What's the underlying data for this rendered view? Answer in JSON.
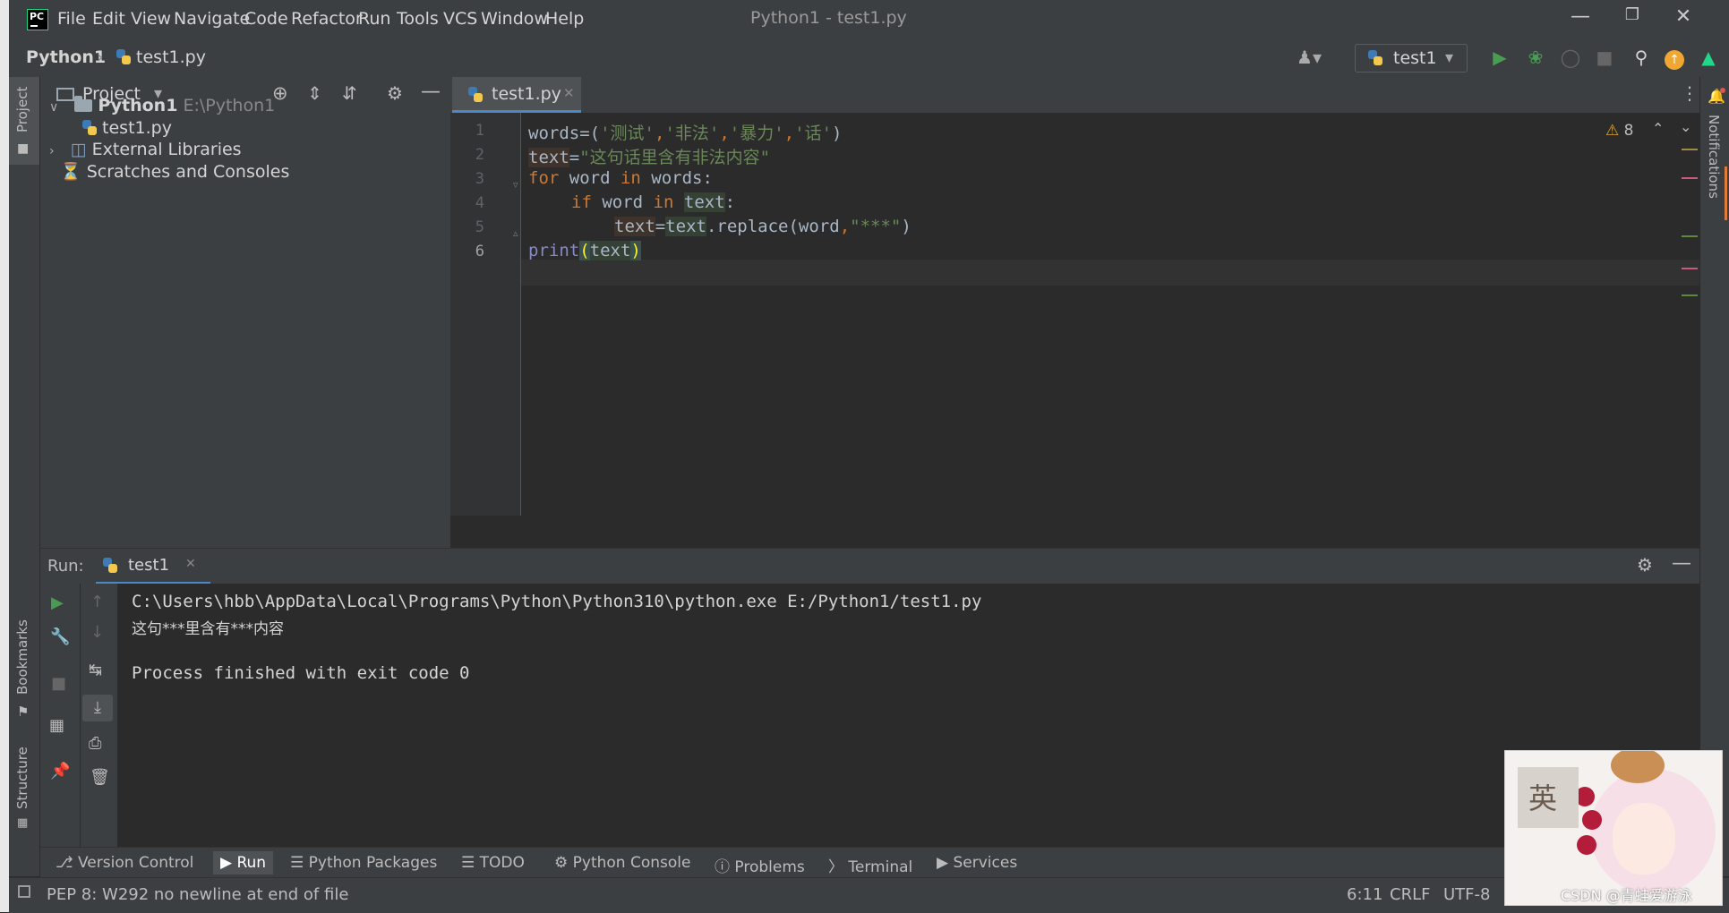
{
  "window": {
    "title": "Python1 - test1.py",
    "menu": [
      "File",
      "Edit",
      "View",
      "Navigate",
      "Code",
      "Refactor",
      "Run",
      "Tools",
      "VCS",
      "Window",
      "Help"
    ]
  },
  "navbar": {
    "project": "Python1",
    "file": "test1.py",
    "run_config": "test1"
  },
  "left_stripe": {
    "project": "Project",
    "bookmarks": "Bookmarks",
    "structure": "Structure"
  },
  "right_stripe": {
    "notifications": "Notifications"
  },
  "project_panel": {
    "title": "Project",
    "root_name": "Python1",
    "root_path": "E:\\Python1",
    "file": "test1.py",
    "external": "External Libraries",
    "scratches": "Scratches and Consoles"
  },
  "editor": {
    "tab": "test1.py",
    "warnings": "8",
    "line_numbers": [
      "1",
      "2",
      "3",
      "4",
      "5",
      "6"
    ],
    "lines": [
      {
        "l1_a": "words",
        "l1_b": "=(",
        "l1_c": "'测试'",
        "l1_d": ",",
        "l1_e": "'非法'",
        "l1_f": ",",
        "l1_g": "'暴力'",
        "l1_h": ",",
        "l1_i": "'话'",
        "l1_j": ")"
      },
      {
        "l2_a": "text",
        "l2_b": "=",
        "l2_c": "\"这句话里含有非法内容\""
      },
      {
        "l3_a": "for",
        "l3_b": " word ",
        "l3_c": "in",
        "l3_d": " words:"
      },
      {
        "l4_a": "if",
        "l4_b": " word ",
        "l4_c": "in",
        "l4_d": " ",
        "l4_e": "text",
        "l4_f": ":"
      },
      {
        "l5_a": "text",
        "l5_b": "=",
        "l5_c": "text",
        "l5_d": ".replace(word",
        "l5_e": ",",
        "l5_f": "\"***\"",
        "l5_g": ")"
      },
      {
        "l6_a": "print",
        "l6_b": "(",
        "l6_c": "text",
        "l6_d": ")"
      }
    ]
  },
  "run_panel": {
    "label": "Run:",
    "tab": "test1",
    "output": [
      "C:\\Users\\hbb\\AppData\\Local\\Programs\\Python\\Python310\\python.exe E:/Python1/test1.py",
      "这句***里含有***内容",
      "",
      "Process finished with exit code 0"
    ]
  },
  "bottom_tabs": [
    "Version Control",
    "Run",
    "Python Packages",
    "TODO",
    "Python Console",
    "Problems",
    "Terminal",
    "Services"
  ],
  "status": {
    "message": "PEP 8: W292 no newline at end of file",
    "position": "6:11",
    "line_sep": "CRLF",
    "encoding": "UTF-8"
  },
  "overlay": {
    "badge_char": "英",
    "watermark": "CSDN @青蛙爱游泳"
  },
  "colors": {
    "accent": "#4a88c7",
    "keyword": "#cc7832",
    "string": "#6a8759",
    "builtin": "#8888c6",
    "run_green": "#499c54"
  }
}
